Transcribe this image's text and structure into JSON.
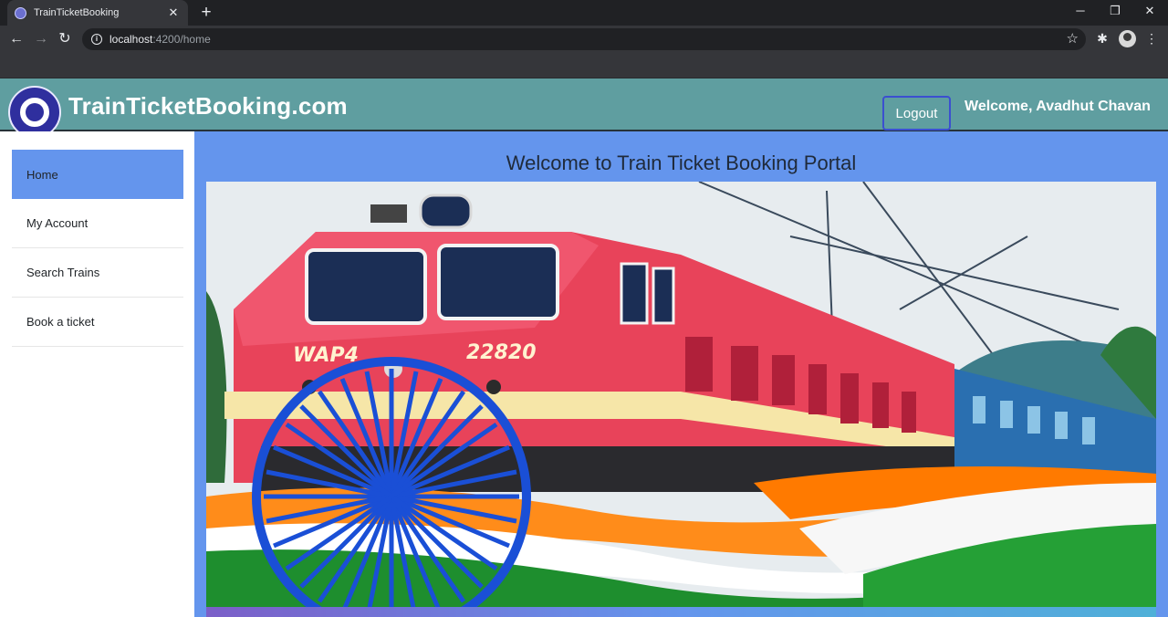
{
  "browser": {
    "tab_title": "TrainTicketBooking",
    "tab_close": "✕",
    "new_tab": "+",
    "url_host": "localhost",
    "url_path": ":4200/home",
    "window_controls": {
      "minimize": "─",
      "maximize": "❐",
      "close": "✕"
    }
  },
  "header": {
    "brand": "TrainTicketBooking.com",
    "logout_label": "Logout",
    "welcome_text": "Welcome, Avadhut Chavan",
    "background_color": "#5f9ea0"
  },
  "sidebar": {
    "items": [
      {
        "label": "Home",
        "active": true
      },
      {
        "label": "My Account",
        "active": false
      },
      {
        "label": "Search Trains",
        "active": false
      },
      {
        "label": "Book a ticket",
        "active": false
      }
    ],
    "active_color": "#6495ed"
  },
  "main": {
    "title": "Welcome to Train Ticket Booking Portal",
    "background_color": "#6495ed",
    "banner": {
      "locomotive_text": "WAP4",
      "locomotive_number": "22820",
      "flag_colors": {
        "saffron": "#ff8c1a",
        "white": "#ffffff",
        "green": "#1e8e2e",
        "chakra": "#1a4fd6"
      }
    }
  }
}
